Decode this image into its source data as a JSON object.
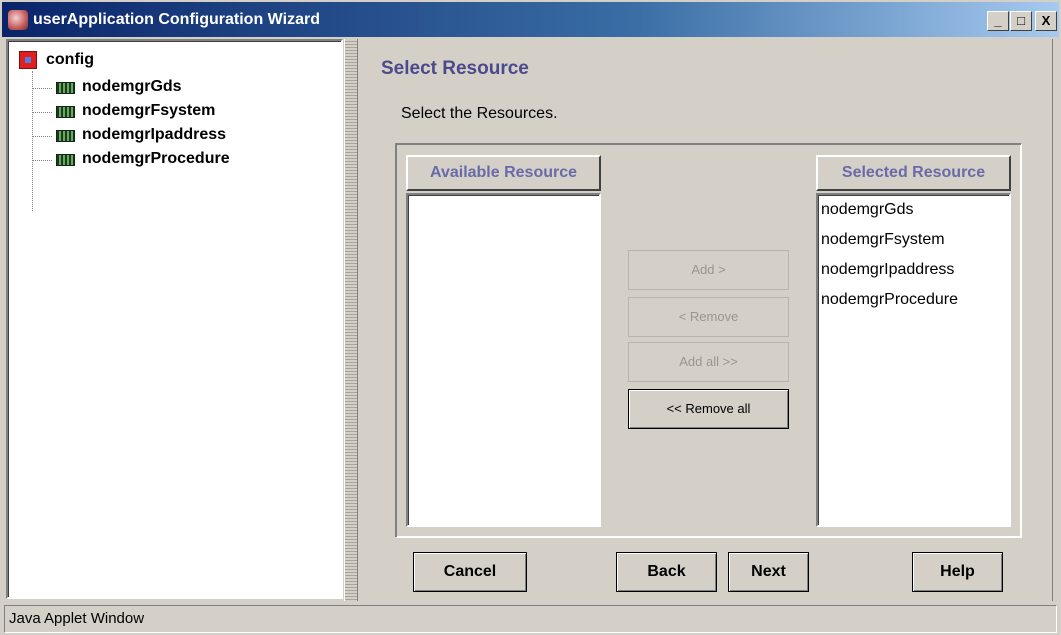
{
  "window": {
    "title": "userApplication Configuration Wizard",
    "minimize_glyph": "_",
    "maximize_glyph": "□",
    "close_glyph": "X",
    "status_text": "Java Applet Window"
  },
  "tree": {
    "root": "config",
    "items": [
      {
        "label": "nodemgrGds"
      },
      {
        "label": "nodemgrFsystem"
      },
      {
        "label": "nodemgrIpaddress"
      },
      {
        "label": "nodemgrProcedure"
      }
    ]
  },
  "main": {
    "title": "Select Resource",
    "instruction": "Select the Resources.",
    "available_header": "Available Resource",
    "selected_header": "Selected Resource",
    "available_items": [],
    "selected_items": [
      {
        "label": "nodemgrGds"
      },
      {
        "label": "nodemgrFsystem"
      },
      {
        "label": "nodemgrIpaddress"
      },
      {
        "label": "nodemgrProcedure"
      }
    ],
    "buttons": {
      "add": "Add >",
      "remove": "< Remove",
      "add_all": "Add all >>",
      "remove_all": "<< Remove all"
    }
  },
  "footer": {
    "cancel": "Cancel",
    "back": "Back",
    "next": "Next",
    "help": "Help"
  }
}
